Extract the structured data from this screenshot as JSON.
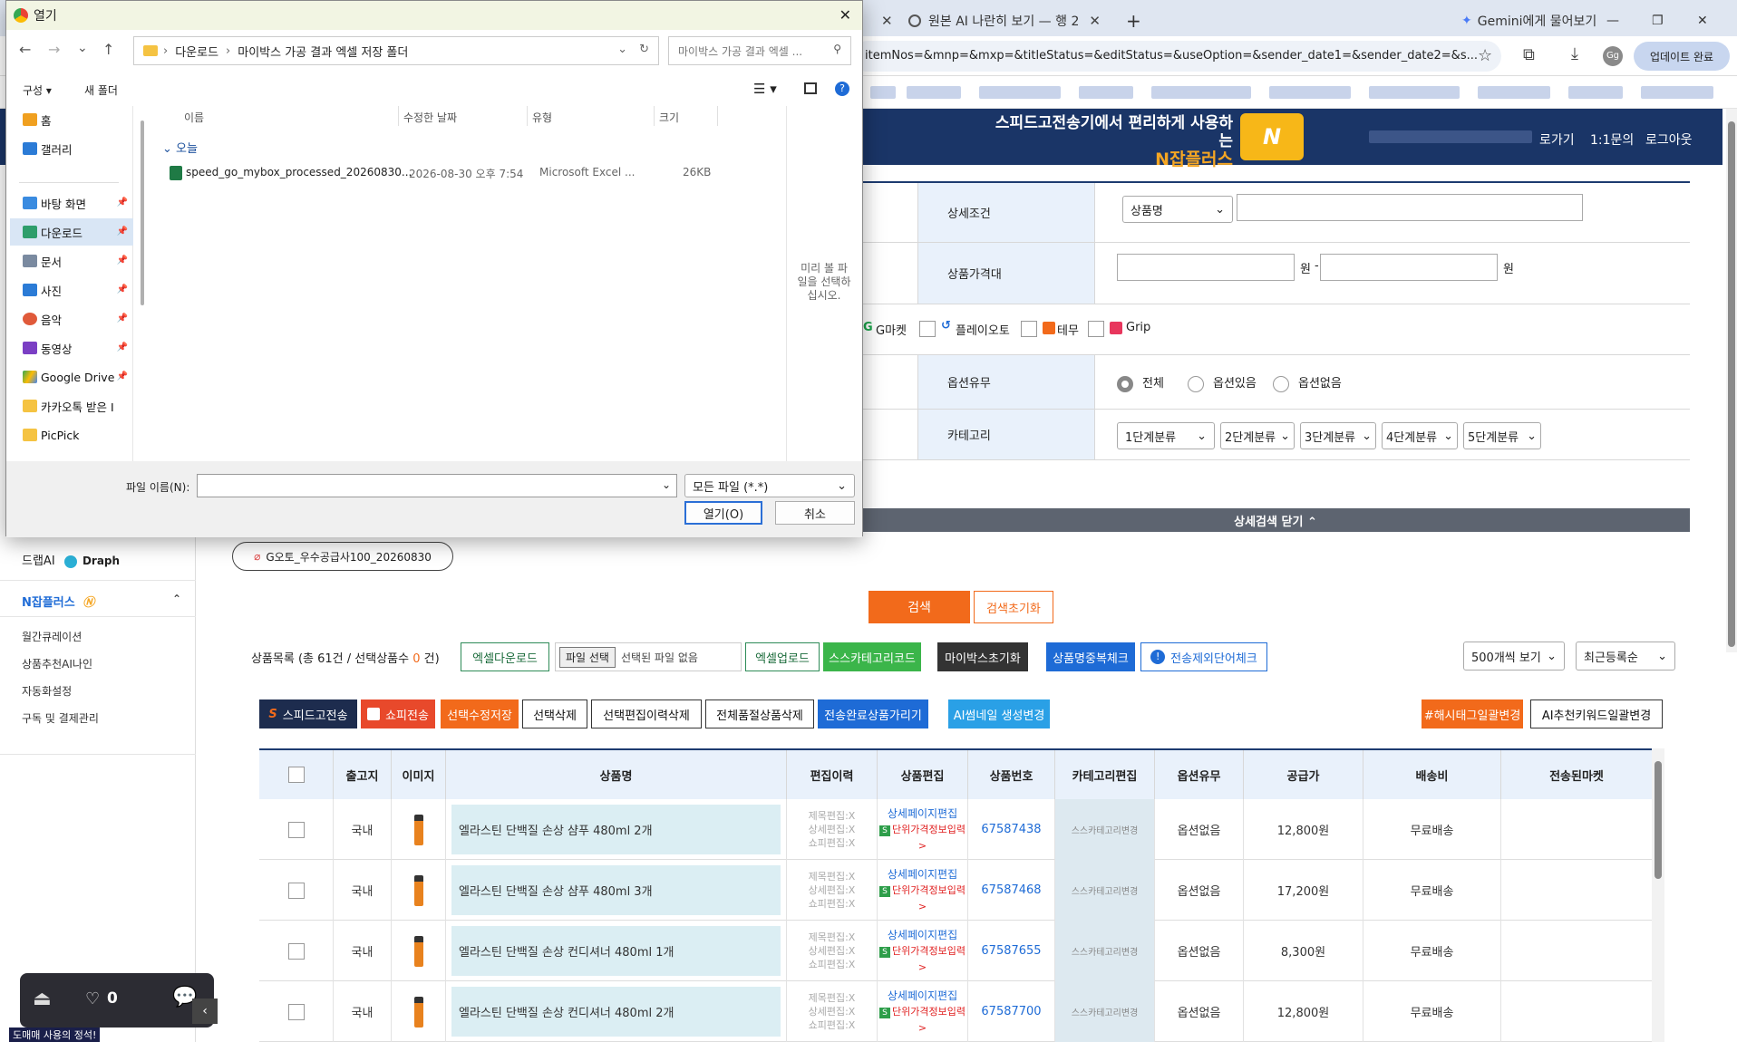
{
  "browser": {
    "tabs": [
      {
        "label": "원본 AI 나란히 보기 — 행 2",
        "close": "✕"
      },
      {
        "label": "Gemini에게 물어보기",
        "close": ""
      }
    ],
    "new_tab": "+",
    "url": "itemNos=&mnp=&mxp=&titleStatus=&editStatus=&useOption=&sender_date1=&sender_date2=&s...",
    "profile": "Gg",
    "update_button": "업데이트 완료",
    "window_controls": [
      "—",
      "❐",
      "✕"
    ]
  },
  "site_header": {
    "promo_line1": "스피드고전송기에서 편리하게 사용하는",
    "promo_brand": "N잡플러스",
    "links": [
      "로가기",
      "1:1문의",
      "로그아웃"
    ]
  },
  "search": {
    "detail_label": "상세조건",
    "detail_select": "상품명",
    "price_label": "상품가격대",
    "price_unit": "원",
    "price_sep": "-",
    "markets": [
      "G마켓",
      "플레이오토",
      "테무",
      "Grip"
    ],
    "option_label": "옵션유무",
    "option_choices": [
      "전체",
      "옵션있음",
      "옵션없음"
    ],
    "category_label": "카테고리",
    "category_selects": [
      "1단계분류",
      "2단계분류",
      "3단계분류",
      "4단계분류",
      "5단계분류"
    ],
    "close_detail": "상세검색 닫기 ⌃",
    "saved_tag": "G오토_우수공급사100_20260830",
    "search_button": "검색",
    "reset_button": "검색초기화"
  },
  "sidebar": {
    "draph": "드랩AI",
    "draph_brand": "Draph",
    "njob_title": "N잡플러스",
    "items": [
      "월간큐레이션",
      "상품추천AI나인",
      "자동화설정",
      "구독 및 결제관리"
    ]
  },
  "list": {
    "summary_prefix": "상품목록 (총 61건 / 선택상품수",
    "selected_count": "0",
    "summary_suffix": "건)",
    "toolbar1": [
      "엑셀다운로드",
      "파일 선택",
      "선택된 파일 없음",
      "엑셀업로드",
      "스스카테고리코드",
      "마이박스초기화",
      "상품명중복체크",
      "전송제외단어체크"
    ],
    "page_size": "500개씩 보기",
    "sort": "최근등록순",
    "toolbar2": [
      "스피드고전송",
      "쇼피전송",
      "선택수정저장",
      "선택삭제",
      "선택편집이력삭제",
      "전체품절상품삭제",
      "전송완료상품가리기",
      "AI썸네일 생성변경"
    ],
    "toolbar2_right": [
      "#해시태그일괄변경",
      "AI추천키워드일괄변경"
    ],
    "columns": [
      "",
      "출고지",
      "이미지",
      "상품명",
      "편집이력",
      "상품편집",
      "상품번호",
      "카테고리편집",
      "옵션유무",
      "공급가",
      "배송비",
      "전송된마켓"
    ],
    "edit_history": [
      "제목편집:X",
      "상세편집:X",
      "쇼피편집:X"
    ],
    "edit_links": [
      "상세페이지편집",
      "단위가격정보입력>"
    ],
    "category_edit": "스스카테고리변경",
    "rows": [
      {
        "origin": "국내",
        "name": "엘라스틴 단백질 손상 샴푸 480ml 2개",
        "no": "67587438",
        "option": "옵션없음",
        "price": "12,800원",
        "ship": "무료배송"
      },
      {
        "origin": "국내",
        "name": "엘라스틴 단백질 손상 샴푸 480ml 3개",
        "no": "67587468",
        "option": "옵션없음",
        "price": "17,200원",
        "ship": "무료배송"
      },
      {
        "origin": "국내",
        "name": "엘라스틴 단백질 손상 컨디셔너 480ml 1개",
        "no": "67587655",
        "option": "옵션없음",
        "price": "8,300원",
        "ship": "무료배송"
      },
      {
        "origin": "국내",
        "name": "엘라스틴 단백질 손상 컨디셔너 480ml 2개",
        "no": "67587700",
        "option": "옵션없음",
        "price": "12,800원",
        "ship": "무료배송"
      }
    ]
  },
  "dialog": {
    "title": "열기",
    "path": [
      "다운로드",
      "마이박스 가공 결과 엑셀 저장 폴더"
    ],
    "search_placeholder": "마이박스 가공 결과 엑셀 ...",
    "organize": "구성 ▾",
    "new_folder": "새 폴더",
    "nav": [
      "홈",
      "갤러리",
      "바탕 화면",
      "다운로드",
      "문서",
      "사진",
      "음악",
      "동영상",
      "Google Drive",
      "카카오톡 받은 I",
      "PicPick"
    ],
    "columns": [
      "이름",
      "수정한 날짜",
      "유형",
      "크기"
    ],
    "group": "오늘",
    "file": {
      "name": "speed_go_mybox_processed_20260830...",
      "date": "2026-08-30 오후 7:54",
      "type": "Microsoft Excel ...",
      "size": "26KB"
    },
    "preview_text": "미리 볼 파일을 선택하십시오.",
    "filename_label": "파일 이름(N):",
    "filter": "모든 파일 (*.*)",
    "open_button": "열기(O)",
    "cancel_button": "취소"
  },
  "widget": {
    "count": "0",
    "bottom_text": "도매매 사용의 정석!"
  },
  "colors": {
    "navy": "#1a3567",
    "orange": "#f26a1b",
    "green": "#3bb54a",
    "blue": "#1e6bd6"
  }
}
